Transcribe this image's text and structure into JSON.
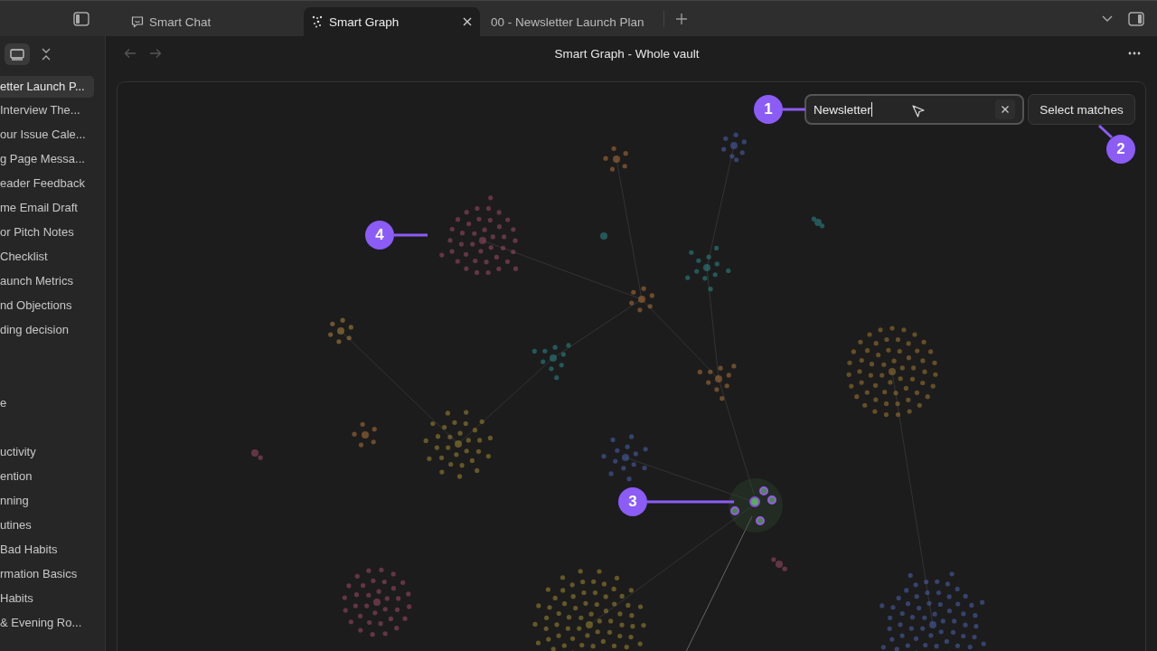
{
  "tabs": [
    {
      "label": "Smart Chat",
      "kind": "chat",
      "selected": false
    },
    {
      "label": "Smart Graph",
      "kind": "graph",
      "selected": true
    },
    {
      "label": "00 - Newsletter Launch Plan",
      "kind": "note",
      "selected": false
    }
  ],
  "view": {
    "title": "Smart Graph - Whole vault"
  },
  "sidebar": {
    "groups": [
      [
        {
          "label": "etter Launch P...",
          "selected": true
        },
        {
          "label": "Interview The...",
          "selected": false
        },
        {
          "label": "our Issue Cale...",
          "selected": false
        },
        {
          "label": "g Page Messa...",
          "selected": false
        },
        {
          "label": "eader Feedback",
          "selected": false
        },
        {
          "label": "me Email Draft",
          "selected": false
        },
        {
          "label": "or Pitch Notes",
          "selected": false
        },
        {
          "label": "Checklist",
          "selected": false
        },
        {
          "label": "aunch Metrics",
          "selected": false
        },
        {
          "label": "nd Objections",
          "selected": false
        },
        {
          "label": "ding decision",
          "selected": false
        }
      ],
      [
        {
          "label": "e",
          "selected": false
        }
      ],
      [
        {
          "label": "uctivity",
          "selected": false
        },
        {
          "label": "ention",
          "selected": false
        },
        {
          "label": "nning",
          "selected": false
        },
        {
          "label": "utines",
          "selected": false
        },
        {
          "label": "Bad Habits",
          "selected": false
        },
        {
          "label": "rmation Basics",
          "selected": false
        },
        {
          "label": "Habits",
          "selected": false
        },
        {
          "label": "& Evening Ro...",
          "selected": false
        }
      ]
    ]
  },
  "search": {
    "value": "Newsletter"
  },
  "select_button": "Select matches",
  "callouts": [
    "1",
    "2",
    "3",
    "4"
  ]
}
